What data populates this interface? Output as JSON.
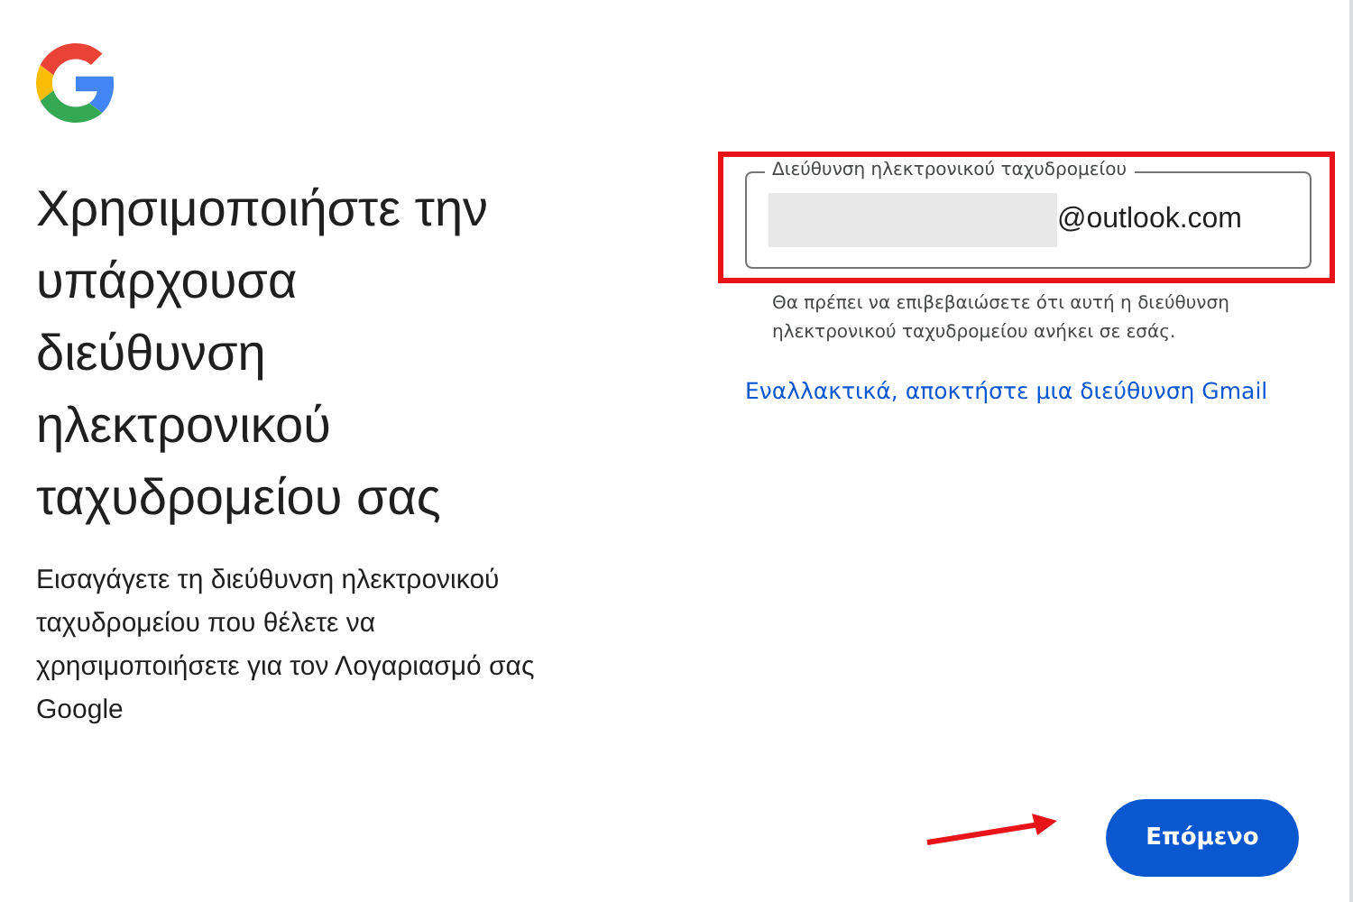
{
  "heading": "Χρησιμοποιήστε την υπάρχουσα διεύθυνση ηλεκτρονικού ταχυδρομείου σας",
  "description": "Εισαγάγετε τη διεύθυνση ηλεκτρονικού ταχυδρομείου που θέλετε να χρησιμοποιήσετε για τον Λογαριασμό σας Google",
  "email_field": {
    "label": "Διεύθυνση ηλεκτρονικού ταχυδρομείου",
    "value": "@outlook.com",
    "redacted": true,
    "highlighted": true
  },
  "hint": "Θα πρέπει να επιβεβαιώσετε ότι αυτή η διεύθυνση ηλεκτρονικού ταχυδρομείου ανήκει σε εσάς.",
  "alt_link": "Εναλλακτικά, αποκτήστε μια διεύθυνση Gmail",
  "next_button": {
    "label": "Επόμενο",
    "pointed": true
  }
}
